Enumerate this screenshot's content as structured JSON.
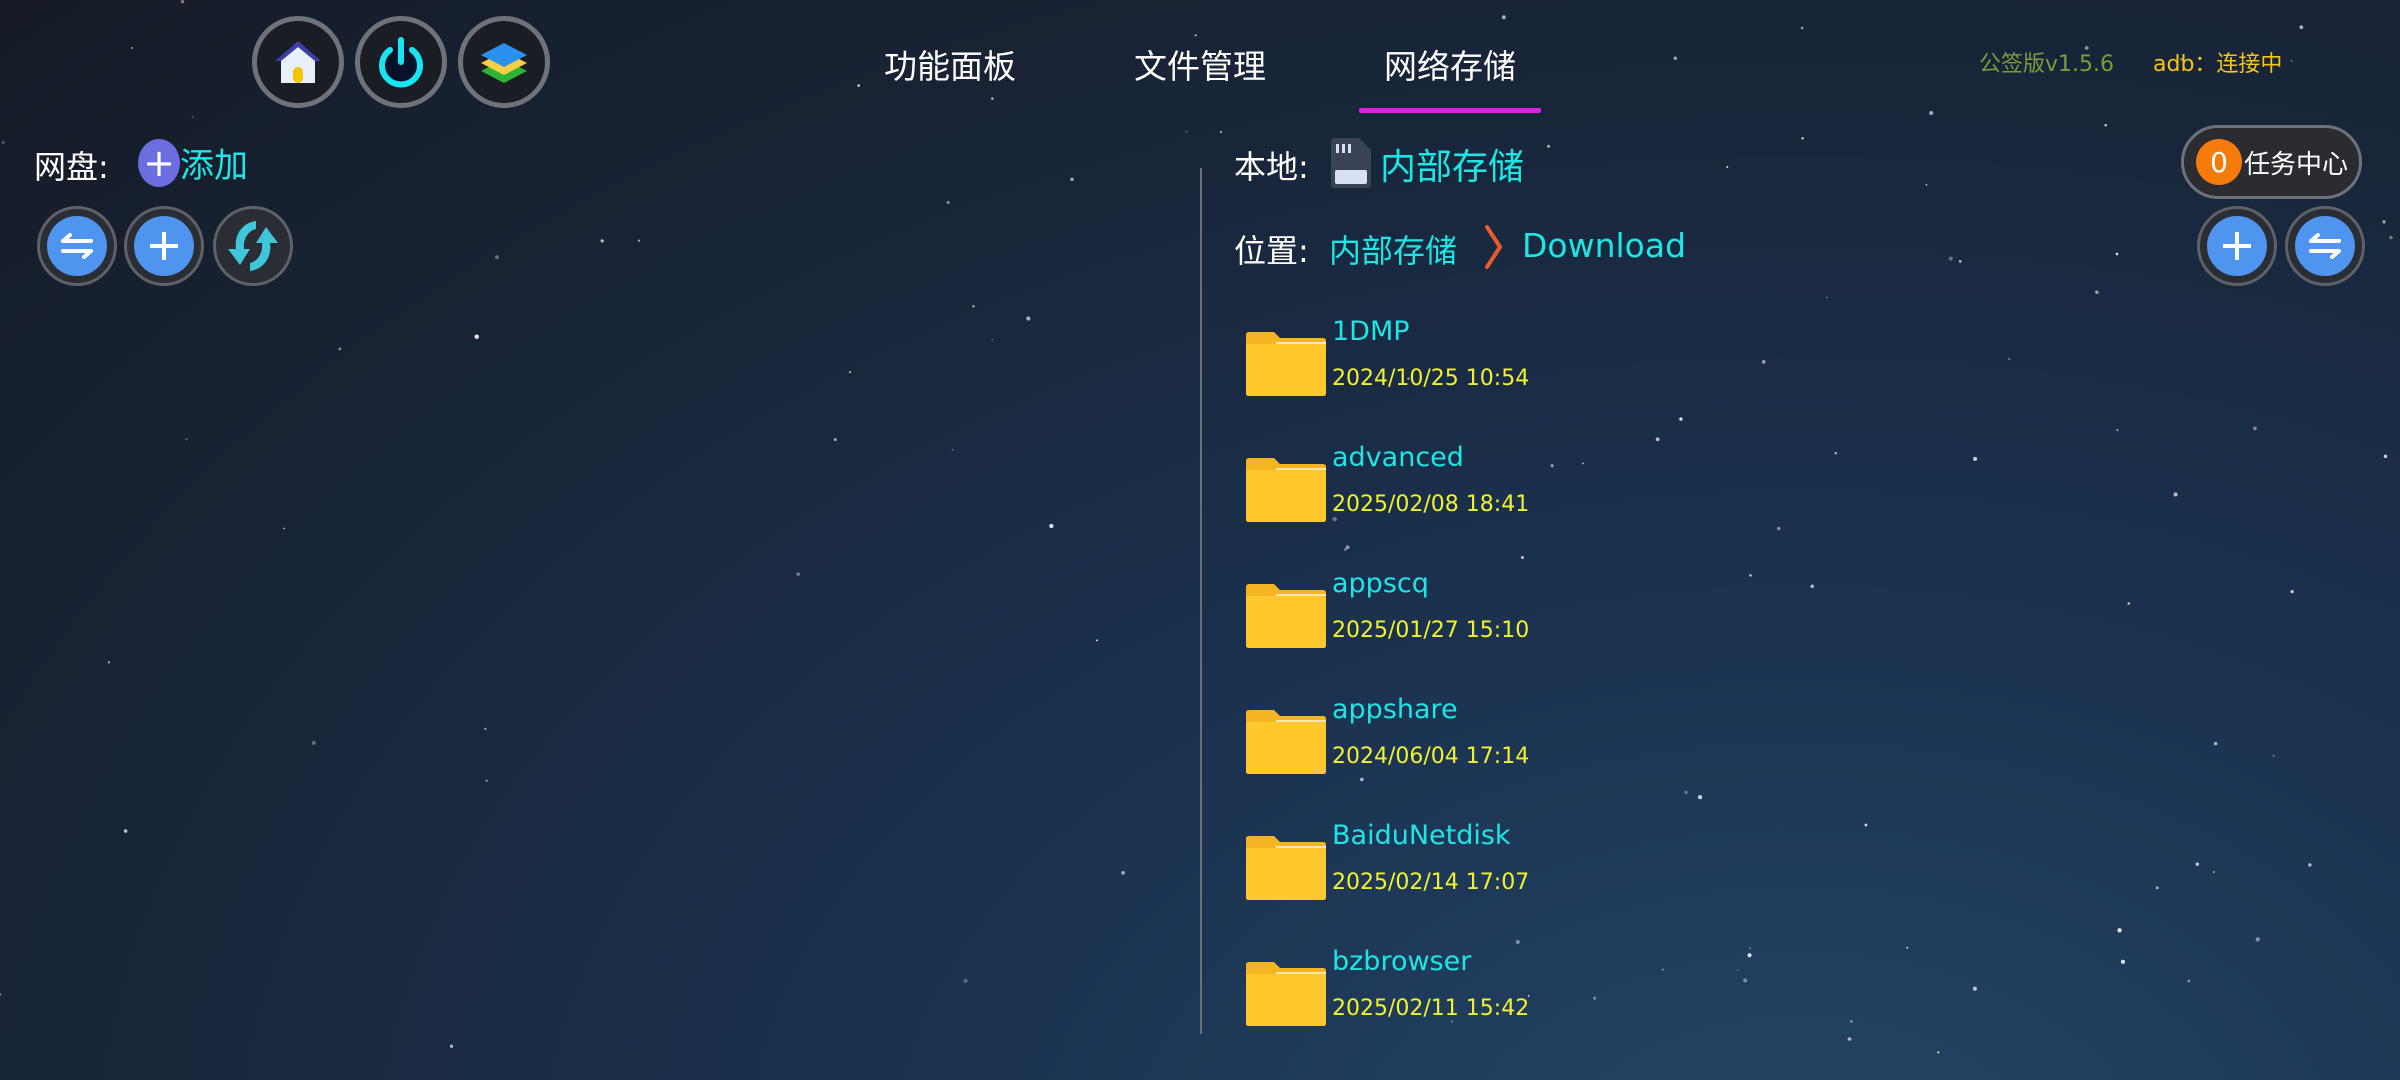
{
  "top_bar": {
    "icons": [
      "home-icon",
      "power-icon",
      "layers-icon"
    ],
    "tabs": [
      {
        "label": "功能面板"
      },
      {
        "label": "文件管理"
      },
      {
        "label": "网络存储",
        "active": true
      }
    ],
    "version": "公签版v1.5.6",
    "adb_status": "adb：连接中",
    "accent_color": "#e020e0"
  },
  "left_panel": {
    "label": "网盘:",
    "add_label": "添加",
    "buttons": [
      "swap-icon",
      "add-icon",
      "sync-icon"
    ]
  },
  "right_panel": {
    "local_label": "本地:",
    "storage_name": "内部存储",
    "location_label": "位置:",
    "breadcrumb": [
      "内部存储",
      "Download"
    ],
    "task_count": "0",
    "task_center": "任务中心",
    "files": [
      {
        "name": "1DMP",
        "date": "2024/10/25 10:54"
      },
      {
        "name": "advanced",
        "date": "2025/02/08 18:41"
      },
      {
        "name": "appscq",
        "date": "2025/01/27 15:10"
      },
      {
        "name": "appshare",
        "date": "2024/06/04 17:14"
      },
      {
        "name": "BaiduNetdisk",
        "date": "2025/02/14 17:07"
      },
      {
        "name": "bzbrowser",
        "date": "2025/02/11 15:42"
      }
    ]
  }
}
